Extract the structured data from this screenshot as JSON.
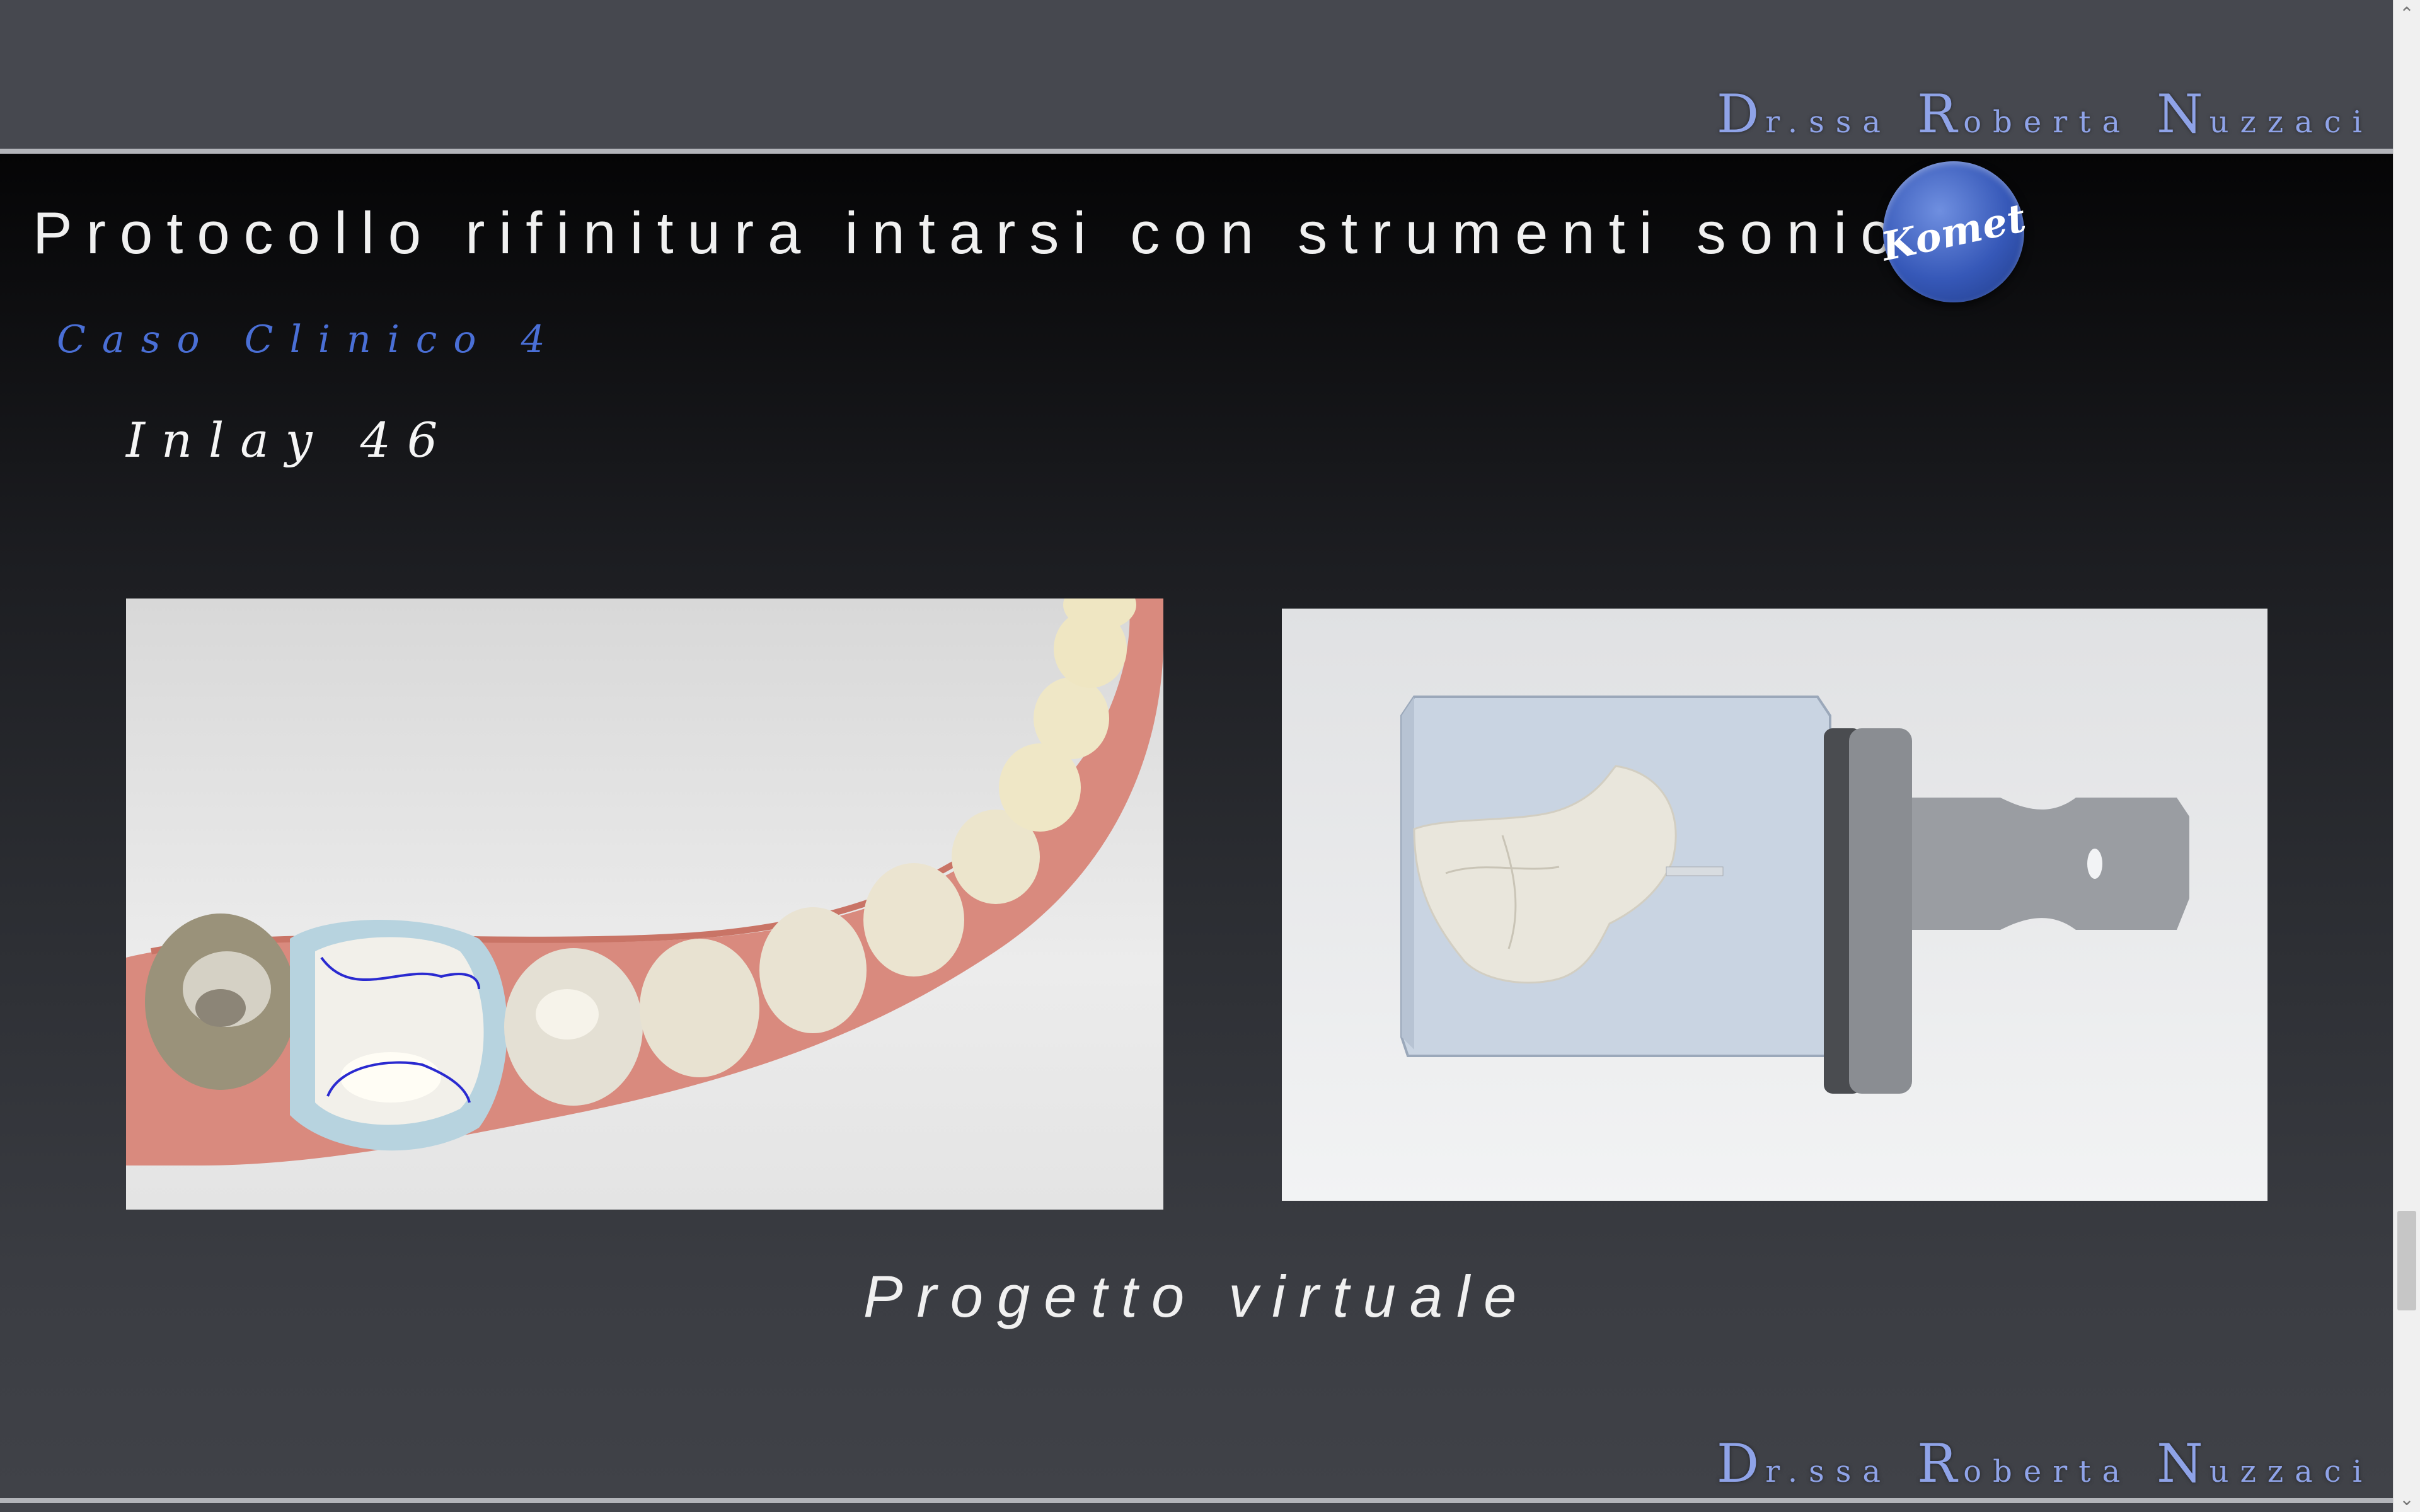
{
  "header": {
    "author": {
      "p1_cap": "D",
      "p1_rest": "r.ssa",
      "p2_cap": "R",
      "p2_rest": "oberta",
      "p3_cap": "N",
      "p3_rest": "uzzaci"
    }
  },
  "slide": {
    "title": "Protocollo rifinitura intarsi con strumenti sonici",
    "logo_text": "Komet",
    "case_label": "Caso Clinico 4",
    "subtitle": "Inlay 46",
    "caption": "Progetto virtuale",
    "images": [
      {
        "name": "virtual-arch-scan",
        "icon": "dental-arch-3d-scan"
      },
      {
        "name": "milling-block-design",
        "icon": "milling-block-3d"
      }
    ]
  },
  "footer": {
    "author": {
      "p1_cap": "D",
      "p1_rest": "r.ssa",
      "p2_cap": "R",
      "p2_rest": "oberta",
      "p3_cap": "N",
      "p3_rest": "uzzaci"
    }
  },
  "scrollbar": {
    "up_icon": "chevron-up-icon",
    "down_icon": "chevron-down-icon",
    "up_glyph": "⌃",
    "down_glyph": "⌄"
  },
  "colors": {
    "accent_blue": "#4a6fd6",
    "author_blue": "#8fa3e8",
    "logo_blue": "#3658b8"
  }
}
